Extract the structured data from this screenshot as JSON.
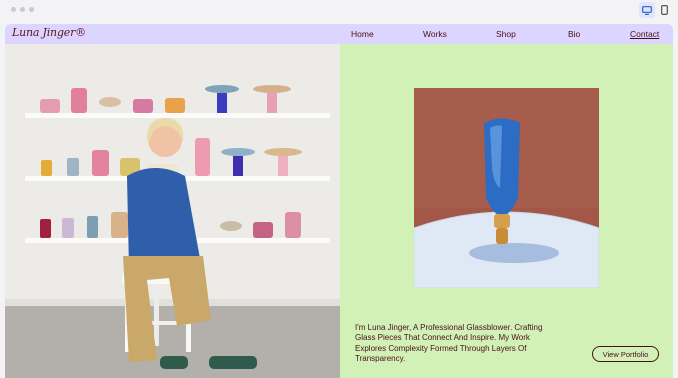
{
  "brand": {
    "logo": "Luna Jinger®"
  },
  "nav": {
    "home": "Home",
    "works": "Works",
    "shop": "Shop",
    "bio": "Bio",
    "contact": "Contact"
  },
  "hero": {
    "intro": "I'm Luna Jinger, A Professional Glassblower. Crafting Glass Pieces That Connect And Inspire. My Work Explores Complexity Formed Through Layers Of Transparency.",
    "cta_label": "View Portfolio"
  },
  "icons": {
    "window_dots": "window-control-icon",
    "desktop": "desktop-icon",
    "mobile": "mobile-icon"
  },
  "colors": {
    "nav_bg": "#dcd5ff",
    "page_bg": "#d2f1b6",
    "text": "#4a0f1c"
  }
}
